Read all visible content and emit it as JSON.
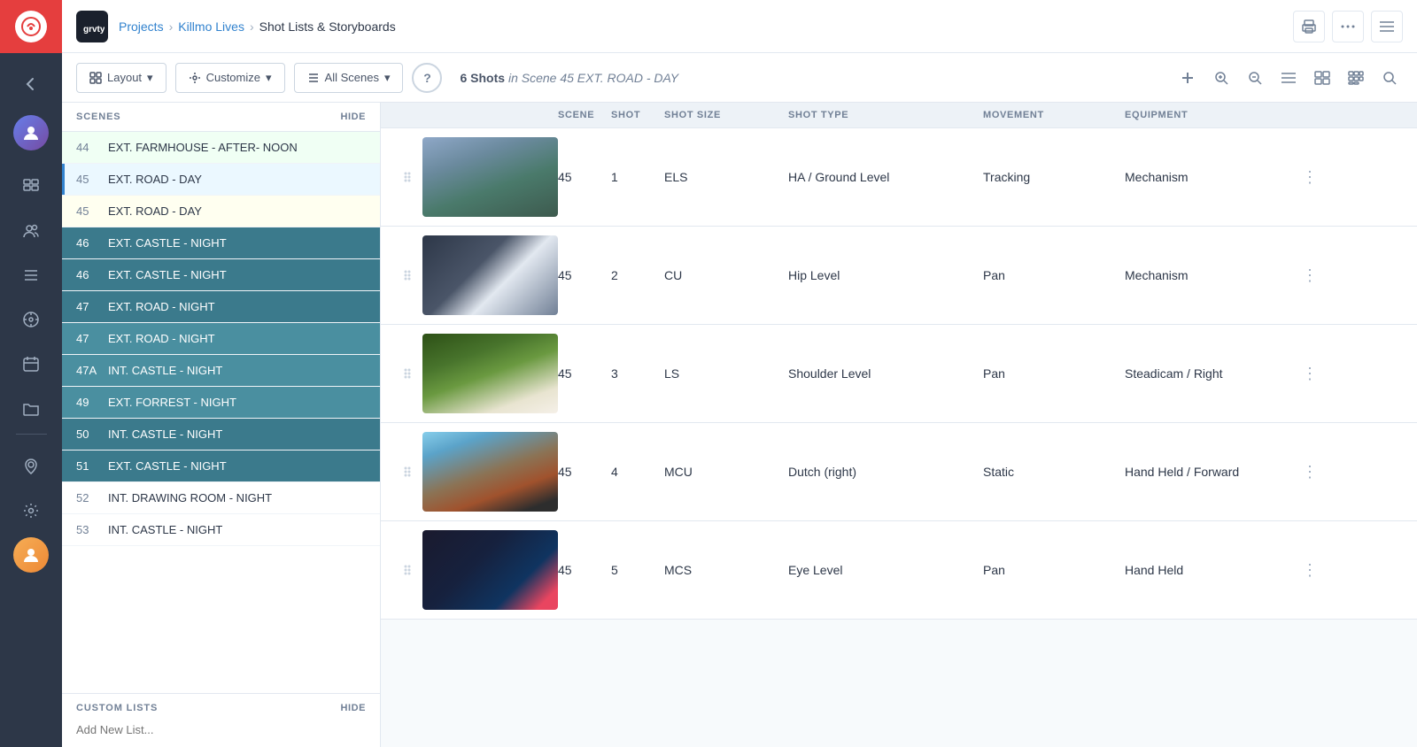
{
  "app": {
    "title": "Shot Lists & Storyboards",
    "logo_text": "Gravity"
  },
  "breadcrumb": {
    "projects_label": "Projects",
    "project_label": "Killmo Lives",
    "current_label": "Shot Lists & Storyboards"
  },
  "toolbar": {
    "layout_label": "Layout",
    "customize_label": "Customize",
    "all_scenes_label": "All Scenes",
    "help_label": "?",
    "scene_count": "6 Shots",
    "scene_info": "in Scene 45 EXT. ROAD - DAY"
  },
  "scenes_panel": {
    "header_label": "SCENES",
    "hide_label": "HIDE",
    "scenes": [
      {
        "num": "44",
        "name": "EXT. FARMHOUSE - AFTER- NOON",
        "style": "selected-green"
      },
      {
        "num": "45",
        "name": "EXT. ROAD - DAY",
        "style": "highlight-blue",
        "active": true
      },
      {
        "num": "45",
        "name": "EXT. ROAD - DAY",
        "style": "selected-light"
      },
      {
        "num": "46",
        "name": "EXT. CASTLE - NIGHT",
        "style": "active-blue"
      },
      {
        "num": "46",
        "name": "EXT. CASTLE - NIGHT",
        "style": "active-blue"
      },
      {
        "num": "47",
        "name": "EXT. ROAD - NIGHT",
        "style": "active-blue"
      },
      {
        "num": "47",
        "name": "EXT. ROAD - NIGHT",
        "style": "active-teal"
      },
      {
        "num": "47A",
        "name": "INT. CASTLE - NIGHT",
        "style": "active-teal"
      },
      {
        "num": "49",
        "name": "EXT. FORREST - NIGHT",
        "style": "active-teal"
      },
      {
        "num": "50",
        "name": "INT. CASTLE - NIGHT",
        "style": "active-blue"
      },
      {
        "num": "51",
        "name": "EXT. CASTLE - NIGHT",
        "style": "active-blue"
      },
      {
        "num": "52",
        "name": "INT. DRAWING ROOM - NIGHT",
        "style": ""
      },
      {
        "num": "53",
        "name": "INT. CASTLE - NIGHT",
        "style": ""
      }
    ]
  },
  "custom_lists": {
    "header_label": "CUSTOM LISTS",
    "hide_label": "HIDE",
    "add_placeholder": "Add New List..."
  },
  "shot_list": {
    "columns": [
      "",
      "SCENE",
      "SHOT",
      "SHOT SIZE",
      "SHOT TYPE",
      "MOVEMENT",
      "EQUIPMENT",
      ""
    ],
    "shots": [
      {
        "id": 1,
        "scene": "45",
        "shot": "1",
        "shot_size": "ELS",
        "shot_type": "HA / Ground Level",
        "movement": "Tracking",
        "equipment": "Mechanism",
        "img_class": "img-road"
      },
      {
        "id": 2,
        "scene": "45",
        "shot": "2",
        "shot_size": "CU",
        "shot_type": "Hip Level",
        "movement": "Pan",
        "equipment": "Mechanism",
        "img_class": "img-steering"
      },
      {
        "id": 3,
        "scene": "45",
        "shot": "3",
        "shot_size": "LS",
        "shot_type": "Shoulder Level",
        "movement": "Pan",
        "equipment": "Steadicam / Right",
        "img_class": "img-forest"
      },
      {
        "id": 4,
        "scene": "45",
        "shot": "4",
        "shot_size": "MCU",
        "shot_type": "Dutch (right)",
        "movement": "Static",
        "equipment": "Hand Held / Forward",
        "img_class": "img-mountain"
      },
      {
        "id": 5,
        "scene": "45",
        "shot": "5",
        "shot_size": "MCS",
        "shot_type": "Eye Level",
        "movement": "Pan",
        "equipment": "Hand Held",
        "img_class": "img-interior"
      }
    ]
  },
  "icons": {
    "back": "←",
    "avatar": "👤",
    "storyboard": "▦",
    "people": "👥",
    "list": "☰",
    "wheel": "◎",
    "calendar": "📅",
    "folder": "📁",
    "location": "📍",
    "settings": "⚙",
    "print": "🖨",
    "dots": "•••",
    "menu": "≡",
    "search": "🔍",
    "plus": "+",
    "zoom_in": "🔍",
    "zoom_out": "—",
    "view_list": "☰",
    "view_grid": "⊞",
    "view_module": "⊟",
    "chevron_down": "▾",
    "handle": "⋮⋮",
    "more": "⋮"
  }
}
